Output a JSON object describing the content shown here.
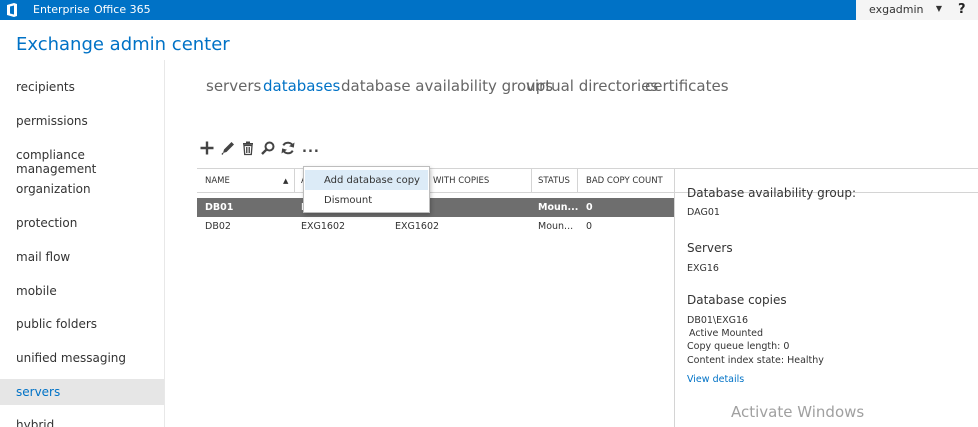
{
  "topbar": {
    "product": "Enterprise",
    "suite": "Office 365",
    "user": "exgadmin",
    "help": "?"
  },
  "app_title": "Exchange admin center",
  "nav": {
    "items": [
      {
        "label": "recipients"
      },
      {
        "label": "permissions"
      },
      {
        "label": "compliance management"
      },
      {
        "label": "organization"
      },
      {
        "label": "protection"
      },
      {
        "label": "mail flow"
      },
      {
        "label": "mobile"
      },
      {
        "label": "public folders"
      },
      {
        "label": "unified messaging"
      },
      {
        "label": "servers",
        "active": true
      },
      {
        "label": "hybrid"
      }
    ]
  },
  "tabs": [
    {
      "label": "servers"
    },
    {
      "label": "databases",
      "active": true
    },
    {
      "label": "database availability groups"
    },
    {
      "label": "virtual directories"
    },
    {
      "label": "certificates"
    }
  ],
  "toolbar": {
    "icons": [
      "add-icon",
      "edit-icon",
      "delete-icon",
      "search-icon",
      "refresh-icon",
      "more-icon"
    ],
    "more_label": "..."
  },
  "table": {
    "headers": {
      "name": "NAME",
      "active_on": "A",
      "copies": "WITH COPIES",
      "status": "STATUS",
      "bad_copy": "BAD COPY COUNT"
    },
    "rows": [
      {
        "name": "DB01",
        "active_on": "E",
        "copies": "",
        "status": "Moun...",
        "bad_copy": "0",
        "selected": true
      },
      {
        "name": "DB02",
        "active_on": "EXG1602",
        "copies": "EXG1602",
        "status": "Moun...",
        "bad_copy": "0"
      }
    ]
  },
  "context_menu": {
    "items": [
      {
        "label": "Add database copy",
        "highlighted": true
      },
      {
        "label": "Dismount"
      }
    ]
  },
  "details": {
    "dag_heading": "Database availability group:",
    "dag_value": "DAG01",
    "servers_heading": "Servers",
    "servers_value": "EXG16",
    "copies_heading": "Database copies",
    "copy_name": "DB01\\EXG16",
    "copy_state": "Active Mounted",
    "copy_queue": "Copy queue length: 0",
    "content_index": "Content index state: Healthy",
    "view_details": "View details"
  },
  "watermark": "Activate Windows",
  "colors": {
    "accent": "#0072c6",
    "selected_row": "#6e6e6e",
    "menu_highlight": "#dcebf7"
  }
}
